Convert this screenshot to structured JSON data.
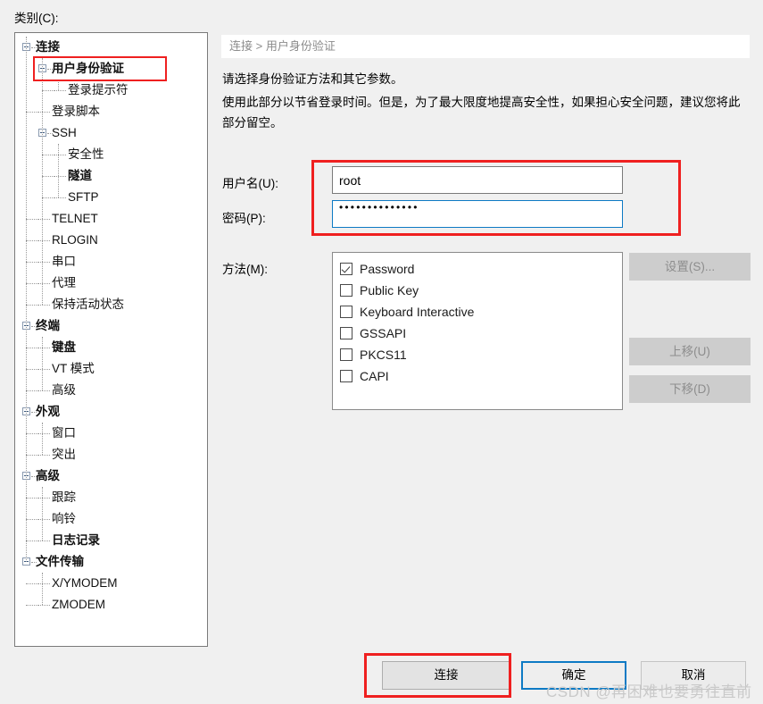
{
  "category_label": "类别(C):",
  "tree": {
    "items": [
      {
        "label": "连接",
        "depth": 0,
        "bold": true,
        "expander": true
      },
      {
        "label": "用户身份验证",
        "depth": 1,
        "bold": true,
        "expander": true,
        "highlight": true
      },
      {
        "label": "登录提示符",
        "depth": 2,
        "bold": false,
        "expander": false
      },
      {
        "label": "登录脚本",
        "depth": 1,
        "bold": false,
        "expander": false
      },
      {
        "label": "SSH",
        "depth": 1,
        "bold": false,
        "expander": true
      },
      {
        "label": "安全性",
        "depth": 2,
        "bold": false,
        "expander": false
      },
      {
        "label": "隧道",
        "depth": 2,
        "bold": true,
        "expander": false
      },
      {
        "label": "SFTP",
        "depth": 2,
        "bold": false,
        "expander": false
      },
      {
        "label": "TELNET",
        "depth": 1,
        "bold": false,
        "expander": false
      },
      {
        "label": "RLOGIN",
        "depth": 1,
        "bold": false,
        "expander": false
      },
      {
        "label": "串口",
        "depth": 1,
        "bold": false,
        "expander": false
      },
      {
        "label": "代理",
        "depth": 1,
        "bold": false,
        "expander": false
      },
      {
        "label": "保持活动状态",
        "depth": 1,
        "bold": false,
        "expander": false
      },
      {
        "label": "终端",
        "depth": 0,
        "bold": true,
        "expander": true
      },
      {
        "label": "键盘",
        "depth": 1,
        "bold": true,
        "expander": false
      },
      {
        "label": "VT 模式",
        "depth": 1,
        "bold": false,
        "expander": false
      },
      {
        "label": "高级",
        "depth": 1,
        "bold": false,
        "expander": false
      },
      {
        "label": "外观",
        "depth": 0,
        "bold": true,
        "expander": true
      },
      {
        "label": "窗口",
        "depth": 1,
        "bold": false,
        "expander": false
      },
      {
        "label": "突出",
        "depth": 1,
        "bold": false,
        "expander": false
      },
      {
        "label": "高级",
        "depth": 0,
        "bold": true,
        "expander": true
      },
      {
        "label": "跟踪",
        "depth": 1,
        "bold": false,
        "expander": false
      },
      {
        "label": "响铃",
        "depth": 1,
        "bold": false,
        "expander": false
      },
      {
        "label": "日志记录",
        "depth": 1,
        "bold": true,
        "expander": false
      },
      {
        "label": "文件传输",
        "depth": 0,
        "bold": true,
        "expander": true
      },
      {
        "label": "X/YMODEM",
        "depth": 1,
        "bold": false,
        "expander": false
      },
      {
        "label": "ZMODEM",
        "depth": 1,
        "bold": false,
        "expander": false
      }
    ]
  },
  "breadcrumb": "连接 > 用户身份验证",
  "description": {
    "line1": "请选择身份验证方法和其它参数。",
    "line2": "使用此部分以节省登录时间。但是，为了最大限度地提高安全性，如果担心安全问题，建议您将此部分留空。"
  },
  "form": {
    "username_label": "用户名(U):",
    "username_value": "root",
    "password_label": "密码(P):",
    "password_value": "••••••••••••••",
    "method_label": "方法(M):"
  },
  "methods": [
    {
      "label": "Password",
      "checked": true
    },
    {
      "label": "Public Key",
      "checked": false
    },
    {
      "label": "Keyboard Interactive",
      "checked": false
    },
    {
      "label": "GSSAPI",
      "checked": false
    },
    {
      "label": "PKCS11",
      "checked": false
    },
    {
      "label": "CAPI",
      "checked": false
    }
  ],
  "side_buttons": {
    "settings": "设置(S)...",
    "move_up": "上移(U)",
    "move_down": "下移(D)"
  },
  "bottom_buttons": {
    "connect": "连接",
    "ok": "确定",
    "cancel": "取消"
  },
  "watermark": "CSDN @再困难也要勇往直前",
  "colors": {
    "highlight_red": "#ef2020",
    "focus_blue": "#0d7ac4",
    "window_bg": "#f0f0f0"
  }
}
